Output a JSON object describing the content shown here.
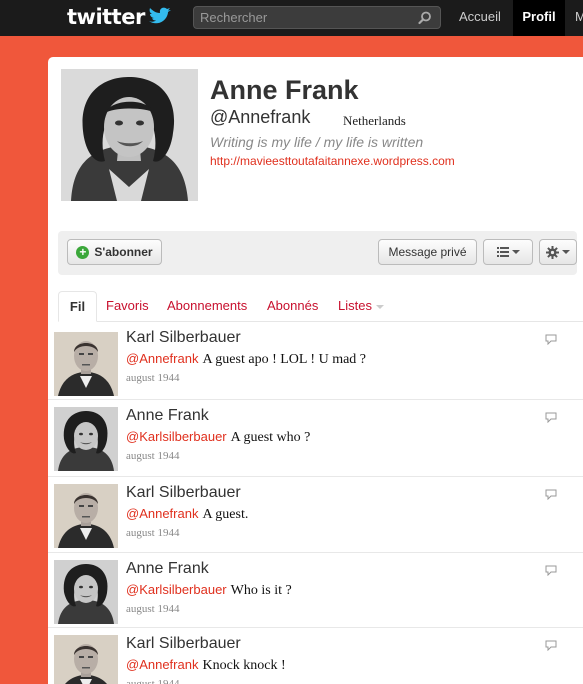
{
  "topbar": {
    "logo": "twitter",
    "search_placeholder": "Rechercher",
    "nav": {
      "home": "Accueil",
      "profile": "Profil",
      "more": "M"
    }
  },
  "profile": {
    "name": "Anne Frank",
    "handle": "@Annefrank",
    "location": "Netherlands",
    "bio": "Writing is my life / my life is written",
    "url": "http://mavieesttoutafaitannexe.wordpress.com"
  },
  "actions": {
    "follow": "S'abonner",
    "message": "Message privé"
  },
  "tabs": [
    {
      "label": "Fil"
    },
    {
      "label": "Favoris"
    },
    {
      "label": "Abonnements"
    },
    {
      "label": "Abonnés"
    },
    {
      "label": "Listes"
    }
  ],
  "tweets": [
    {
      "author": "Karl Silberbauer",
      "mention": "@Annefrank",
      "text": "A guest apo ! LOL ! U mad ?",
      "date": "august 1944"
    },
    {
      "author": "Anne Frank",
      "mention": "@Karlsilberbauer",
      "text": "A guest who ?",
      "date": "august 1944"
    },
    {
      "author": "Karl Silberbauer",
      "mention": "@Annefrank",
      "text": "A guest.",
      "date": "august 1944"
    },
    {
      "author": "Anne Frank",
      "mention": "@Karlsilberbauer",
      "text": "Who is it ?",
      "date": "august 1944"
    },
    {
      "author": "Karl Silberbauer",
      "mention": "@Annefrank",
      "text": "Knock knock !",
      "date": "august 1944"
    }
  ],
  "colors": {
    "background": "#f0573b",
    "topbar": "#1b1b1b",
    "link": "#e0301e",
    "tab_link": "#c8102e",
    "follow_icon": "#3ba73a"
  },
  "icons": [
    "twitter-bird-icon",
    "search-icon",
    "plus-icon",
    "list-icon",
    "gear-icon",
    "reply-icon"
  ]
}
